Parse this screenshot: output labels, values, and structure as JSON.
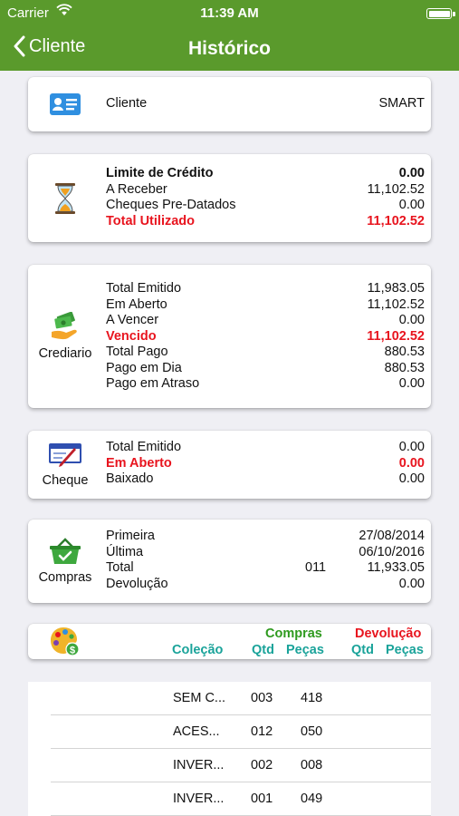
{
  "status": {
    "carrier": "Carrier",
    "time": "11:39 AM"
  },
  "nav": {
    "back_label": "Cliente",
    "title": "Histórico"
  },
  "cliente": {
    "label": "Cliente",
    "value": "SMART"
  },
  "credito": {
    "rows": [
      {
        "label": "Limite de Crédito",
        "value": "0.00"
      },
      {
        "label": "A Receber",
        "value": "11,102.52"
      },
      {
        "label": "Cheques Pre-Datados",
        "value": "0.00"
      },
      {
        "label": "Total Utilizado",
        "value": "11,102.52"
      }
    ]
  },
  "crediario": {
    "label": "Crediario",
    "rows": [
      {
        "label": "Total Emitido",
        "value": "11,983.05"
      },
      {
        "label": "Em Aberto",
        "value": "11,102.52"
      },
      {
        "label": "A Vencer",
        "value": "0.00"
      },
      {
        "label": "Vencido",
        "value": "11,102.52"
      },
      {
        "label": "Total Pago",
        "value": "880.53"
      },
      {
        "label": "Pago em Dia",
        "value": "880.53"
      },
      {
        "label": "Pago em Atraso",
        "value": "0.00"
      }
    ]
  },
  "cheque": {
    "label": "Cheque",
    "rows": [
      {
        "label": "Total Emitido",
        "value": "0.00"
      },
      {
        "label": "Em Aberto",
        "value": "0.00"
      },
      {
        "label": "Baixado",
        "value": "0.00"
      }
    ]
  },
  "compras": {
    "label": "Compras",
    "rows": [
      {
        "label": "Primeira",
        "mid": "",
        "value": "27/08/2014"
      },
      {
        "label": "Última",
        "mid": "",
        "value": "06/10/2016"
      },
      {
        "label": "Total",
        "mid": "011",
        "value": "11,933.05"
      },
      {
        "label": "Devolução",
        "mid": "",
        "value": "0.00"
      }
    ]
  },
  "colecao_header": {
    "compras": "Compras",
    "devolucao": "Devolução",
    "colecao": "Coleção",
    "qtd": "Qtd",
    "pecas": "Peças",
    "dev_qtd": "Qtd",
    "dev_pecas": "Peças"
  },
  "colecao_rows": [
    {
      "name": "SEM C...",
      "qtd": "003",
      "pecas": "418"
    },
    {
      "name": "ACES...",
      "qtd": "012",
      "pecas": "050"
    },
    {
      "name": "INVER...",
      "qtd": "002",
      "pecas": "008"
    },
    {
      "name": "INVER...",
      "qtd": "001",
      "pecas": "049"
    }
  ],
  "colors": {
    "nav_green": "#5a9a2c",
    "alert_red": "#e8141e",
    "compras_green": "#2e9a1e",
    "teal": "#1aa39a"
  },
  "icons": [
    "back-chevron-icon",
    "wifi-icon",
    "battery-icon",
    "id-card-icon",
    "hourglass-icon",
    "money-hand-icon",
    "check-pen-icon",
    "basket-check-icon",
    "palette-dollar-icon"
  ]
}
